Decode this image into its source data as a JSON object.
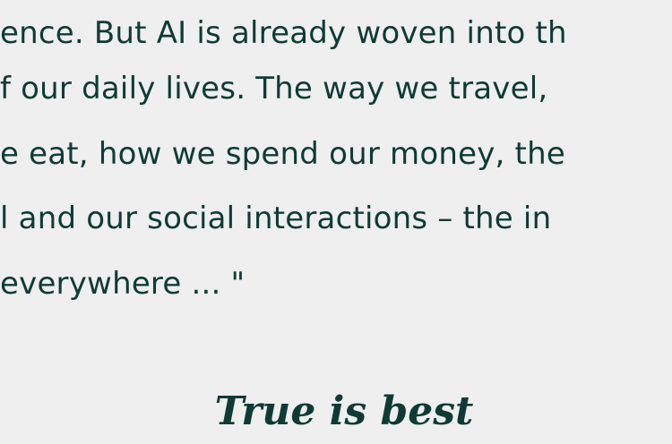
{
  "quote": {
    "lines": [
      "ence. But AI is already woven into th",
      "f our daily lives. The way we travel,",
      "e eat, how we spend our money, the",
      "l and our social interactions – the in",
      "everywhere ... \""
    ]
  },
  "tagline": {
    "text": "True is best"
  },
  "colors": {
    "background": "#efefef",
    "text": "#0f3b34"
  }
}
